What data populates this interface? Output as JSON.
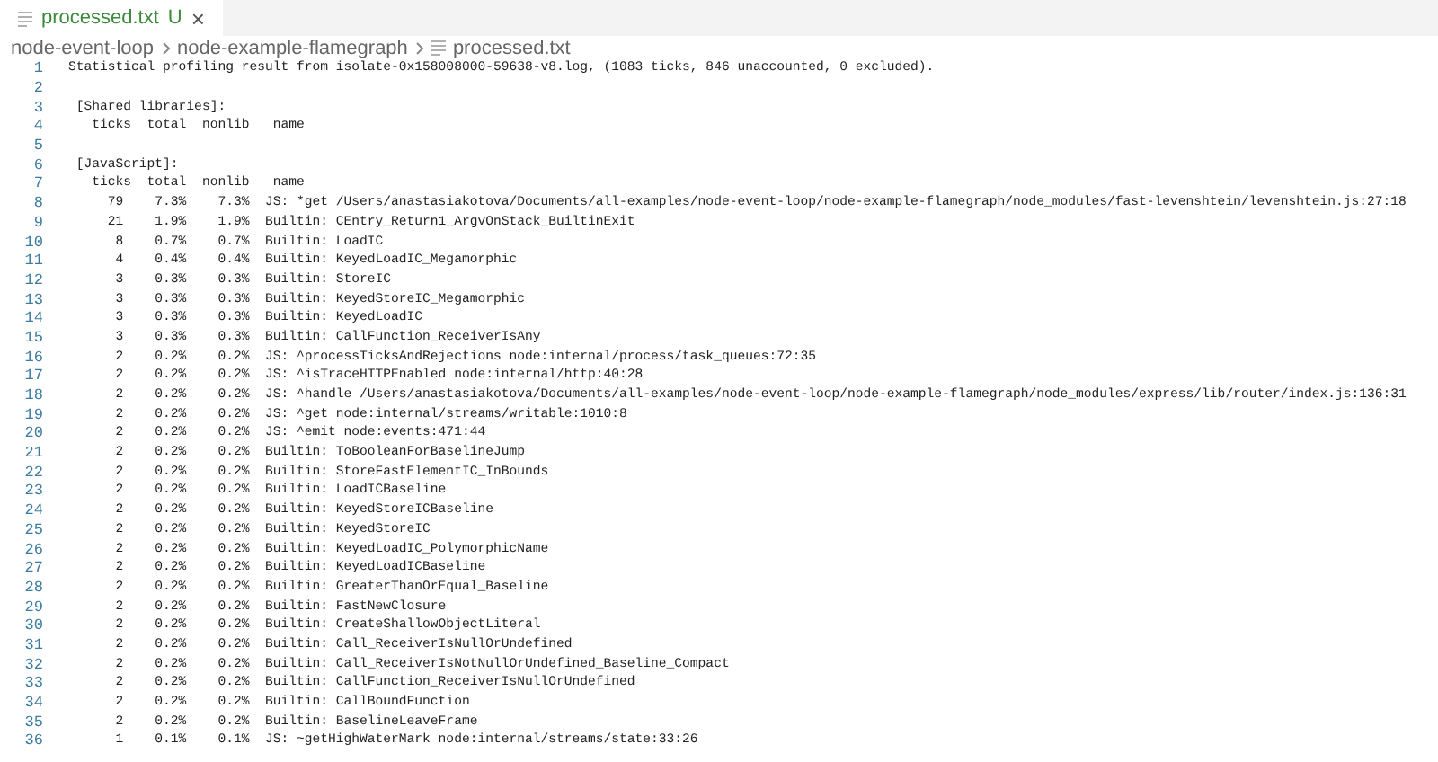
{
  "tabs": [
    {
      "label": "processed.txt",
      "status": "U",
      "close": "×",
      "selected": true
    }
  ],
  "breadcrumbs": [
    "node-event-loop",
    "node-example-flamegraph",
    "processed.txt"
  ],
  "lines": [
    {
      "number": "1",
      "text": "Statistical profiling result from isolate-0x158008000-59638-v8.log, (1083 ticks, 846 unaccounted, 0 excluded)."
    },
    {
      "number": "2"
    },
    {
      "number": "3",
      "text": " [Shared libraries]:"
    },
    {
      "number": "4",
      "text": "   ticks  total  nonlib   name"
    },
    {
      "number": "5"
    },
    {
      "number": "6",
      "text": " [JavaScript]:"
    },
    {
      "number": "7",
      "text": "   ticks  total  nonlib   name"
    },
    {
      "number": "8",
      "text": "     79    7.3%    7.3%  JS: *get /Users/anastasiakotova/Documents/all-examples/node-event-loop/node-example-flamegraph/node_modules/fast-levenshtein/levenshtein.js:27:18"
    },
    {
      "number": "9",
      "text": "     21    1.9%    1.9%  Builtin: CEntry_Return1_ArgvOnStack_BuiltinExit"
    },
    {
      "number": "10",
      "text": "      8    0.7%    0.7%  Builtin: LoadIC"
    },
    {
      "number": "11",
      "text": "      4    0.4%    0.4%  Builtin: KeyedLoadIC_Megamorphic"
    },
    {
      "number": "12",
      "text": "      3    0.3%    0.3%  Builtin: StoreIC"
    },
    {
      "number": "13",
      "text": "      3    0.3%    0.3%  Builtin: KeyedStoreIC_Megamorphic"
    },
    {
      "number": "14",
      "text": "      3    0.3%    0.3%  Builtin: KeyedLoadIC"
    },
    {
      "number": "15",
      "text": "      3    0.3%    0.3%  Builtin: CallFunction_ReceiverIsAny"
    },
    {
      "number": "16",
      "text": "      2    0.2%    0.2%  JS: ^processTicksAndRejections node:internal/process/task_queues:72:35"
    },
    {
      "number": "17",
      "text": "      2    0.2%    0.2%  JS: ^isTraceHTTPEnabled node:internal/http:40:28"
    },
    {
      "number": "18",
      "text": "      2    0.2%    0.2%  JS: ^handle /Users/anastasiakotova/Documents/all-examples/node-event-loop/node-example-flamegraph/node_modules/express/lib/router/index.js:136:31"
    },
    {
      "number": "19",
      "text": "      2    0.2%    0.2%  JS: ^get node:internal/streams/writable:1010:8"
    },
    {
      "number": "20",
      "text": "      2    0.2%    0.2%  JS: ^emit node:events:471:44"
    },
    {
      "number": "21",
      "text": "      2    0.2%    0.2%  Builtin: ToBooleanForBaselineJump"
    },
    {
      "number": "22",
      "text": "      2    0.2%    0.2%  Builtin: StoreFastElementIC_InBounds"
    },
    {
      "number": "23",
      "text": "      2    0.2%    0.2%  Builtin: LoadICBaseline"
    },
    {
      "number": "24",
      "text": "      2    0.2%    0.2%  Builtin: KeyedStoreICBaseline"
    },
    {
      "number": "25",
      "text": "      2    0.2%    0.2%  Builtin: KeyedStoreIC"
    },
    {
      "number": "26",
      "text": "      2    0.2%    0.2%  Builtin: KeyedLoadIC_PolymorphicName"
    },
    {
      "number": "27",
      "text": "      2    0.2%    0.2%  Builtin: KeyedLoadICBaseline"
    },
    {
      "number": "28",
      "text": "      2    0.2%    0.2%  Builtin: GreaterThanOrEqual_Baseline"
    },
    {
      "number": "29",
      "text": "      2    0.2%    0.2%  Builtin: FastNewClosure"
    },
    {
      "number": "30",
      "text": "      2    0.2%    0.2%  Builtin: CreateShallowObjectLiteral"
    },
    {
      "number": "31",
      "text": "      2    0.2%    0.2%  Builtin: Call_ReceiverIsNullOrUndefined"
    },
    {
      "number": "32",
      "text": "      2    0.2%    0.2%  Builtin: Call_ReceiverIsNotNullOrUndefined_Baseline_Compact"
    },
    {
      "number": "33",
      "text": "      2    0.2%    0.2%  Builtin: CallFunction_ReceiverIsNullOrUndefined"
    },
    {
      "number": "34",
      "text": "      2    0.2%    0.2%  Builtin: CallBoundFunction"
    },
    {
      "number": "35",
      "text": "      2    0.2%    0.2%  Builtin: BaselineLeaveFrame"
    },
    {
      "number": "36",
      "text": "      1    0.1%    0.1%  JS: ~getHighWaterMark node:internal/streams/state:33:26"
    }
  ]
}
